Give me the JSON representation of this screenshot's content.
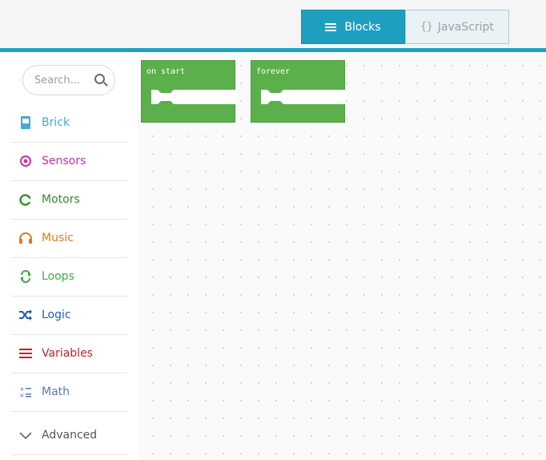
{
  "header": {
    "blocks_label": "Blocks",
    "javascript_icon": "{}",
    "javascript_label": "JavaScript"
  },
  "sidebar": {
    "search_placeholder": "Search...",
    "categories": [
      {
        "label": "Brick",
        "icon": "brick-icon",
        "color": "#45a9dc"
      },
      {
        "label": "Sensors",
        "icon": "sensor-target-icon",
        "color": "#cf2ea8"
      },
      {
        "label": "Motors",
        "icon": "rotate-icon",
        "color": "#2f8f2f"
      },
      {
        "label": "Music",
        "icon": "headphones-icon",
        "color": "#e07a1e"
      },
      {
        "label": "Loops",
        "icon": "loop-icon",
        "color": "#3fae3f"
      },
      {
        "label": "Logic",
        "icon": "shuffle-icon",
        "color": "#1f5db0"
      },
      {
        "label": "Variables",
        "icon": "hamburger-icon",
        "color": "#c6202a"
      },
      {
        "label": "Math",
        "icon": "math-operators-icon",
        "color": "#5a78b7"
      }
    ],
    "advanced_label": "Advanced"
  },
  "workspace": {
    "blocks": [
      {
        "label": "on start"
      },
      {
        "label": "forever"
      }
    ]
  },
  "colors": {
    "accent": "#1fa2c2",
    "block_green": "#5cb04b"
  }
}
